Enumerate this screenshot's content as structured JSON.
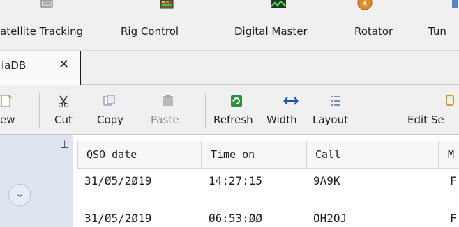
{
  "modules": [
    {
      "name": "satellite-tracking",
      "label": "atellite Tracking",
      "icon": "satellite-icon"
    },
    {
      "name": "rig-control",
      "label": "Rig Control",
      "icon": "rig-icon"
    },
    {
      "name": "digital-master",
      "label": "Digital Master",
      "icon": "waveform-icon"
    },
    {
      "name": "rotator",
      "label": "Rotator",
      "icon": "compass-icon"
    },
    {
      "name": "tuner",
      "label": "Tun",
      "icon": "tuner-icon"
    }
  ],
  "tab": {
    "label": "iaDB",
    "close": "✕"
  },
  "toolbar": {
    "new_label": "ew",
    "cut_label": "Cut",
    "copy_label": "Copy",
    "paste_label": "Paste",
    "refresh_label": "Refresh",
    "width_label": "Width",
    "layout_label": "Layout",
    "edit_label": "Edit Se"
  },
  "leftpane": {
    "pin": "⊥",
    "expand": "⌄"
  },
  "grid": {
    "columns": [
      "QSO date",
      "Time on",
      "Call",
      "M"
    ],
    "rows": [
      [
        "31/Ø5/2Ø19",
        "14:27:15",
        "9A9K",
        "F"
      ],
      [
        "31/Ø5/2Ø19",
        "Ø6:53:ØØ",
        "OH2OJ",
        "F"
      ]
    ]
  },
  "colors": {
    "accent": "#3a7bd5",
    "grid_bg": "#ffffff",
    "left_pane": "#dde4ef"
  }
}
